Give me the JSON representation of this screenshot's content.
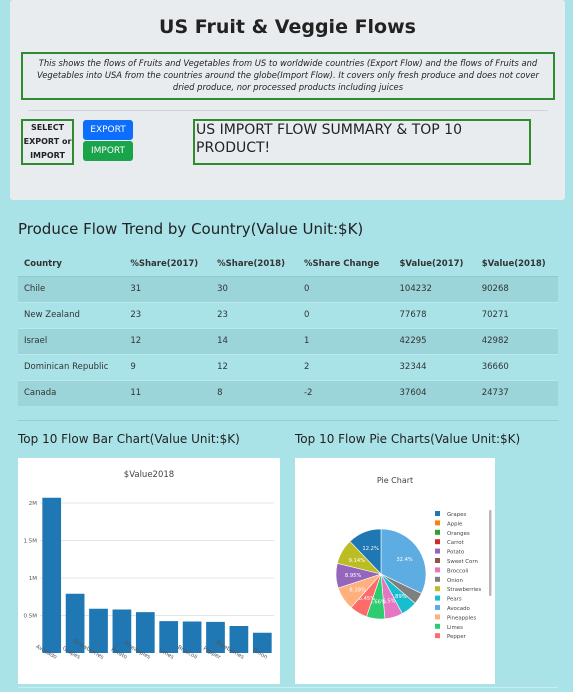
{
  "header": {
    "title": "US Fruit & Veggie Flows",
    "description": "This shows the flows of Fruits and Vegetables from US to worldwide countries (Export Flow) and the flows of Fruits and Vegetables into USA from the countries around the globe(Import Flow). It covers only fresh produce and does not cover dried produce, nor processed products including juices"
  },
  "controls": {
    "select_label_line1": "SELECT",
    "select_label_line2": "EXPORT or",
    "select_label_line3": "IMPORT",
    "export_label": "EXPORT",
    "import_label": "IMPORT",
    "export_color": "#0d6efd",
    "import_color": "#19a34a",
    "summary_title": "US IMPORT FLOW SUMMARY & TOP 10 PRODUCT!"
  },
  "trend": {
    "title": "Produce Flow Trend by Country(Value Unit:$K)",
    "columns": [
      "Country",
      "%Share(2017)",
      "%Share(2018)",
      "%Share Change",
      "$Value(2017)",
      "$Value(2018)"
    ],
    "rows": [
      [
        "Chile",
        "31",
        "30",
        "0",
        "104232",
        "90268"
      ],
      [
        "New Zealand",
        "23",
        "23",
        "0",
        "77678",
        "70271"
      ],
      [
        "Israel",
        "12",
        "14",
        "1",
        "42295",
        "42982"
      ],
      [
        "Dominican Republic",
        "9",
        "12",
        "2",
        "32344",
        "36660"
      ],
      [
        "Canada",
        "11",
        "8",
        "-2",
        "37604",
        "24737"
      ]
    ]
  },
  "bar_section": {
    "title": "Top 10 Flow Bar Chart(Value Unit:$K)"
  },
  "pie_section": {
    "title": "Top 10 Flow Pie Charts(Value Unit:$K)"
  },
  "chart_data": [
    {
      "type": "bar",
      "title": "$Value2018",
      "categories": [
        "Avocado",
        "Grapes",
        "Strawberries",
        "Potato",
        "Pineapples",
        "Limes",
        "Broccoli",
        "Pepper",
        "Blueberries",
        "Onion"
      ],
      "values": [
        2070000,
        790000,
        590000,
        580000,
        545000,
        425000,
        420000,
        415000,
        360000,
        270000
      ],
      "ylim": [
        0,
        2200000
      ],
      "yticks": [
        "2M",
        "1.5M",
        "1M",
        "0.5M"
      ],
      "ytick_values": [
        2000000,
        1500000,
        1000000,
        500000
      ],
      "bar_color": "#1f77b4",
      "grid": true
    },
    {
      "type": "pie",
      "title": "Pie Chart",
      "labels": [
        "Grapes",
        "Apple",
        "Oranges",
        "Carrot",
        "Potato",
        "Sweet Corn",
        "Broccoli",
        "Onion",
        "Strawberries",
        "Pears",
        "Avocado",
        "Pineapples",
        "Limes",
        "Pepper"
      ],
      "colors": [
        "#1f77b4",
        "#ff7f0e",
        "#2ca02c",
        "#d62728",
        "#9467bd",
        "#8c564b",
        "#e377c2",
        "#7f7f7f",
        "#bcbd22",
        "#17becf",
        "#5dade2",
        "#ffb07c",
        "#2ecc71",
        "#ff6b6b"
      ],
      "slices": [
        {
          "label": "Avocado",
          "value": 32.4,
          "color": "#5dade2",
          "text": "32.4%"
        },
        {
          "label": "Onion",
          "value": 4.2,
          "color": "#7f7f7f",
          "text": ""
        },
        {
          "label": "Pears",
          "value": 5.89,
          "color": "#17becf",
          "text": "5.89%"
        },
        {
          "label": "Broccoli",
          "value": 6.5,
          "color": "#e377c2",
          "text": "6.5%"
        },
        {
          "label": "Limes",
          "value": 6.66,
          "color": "#2ecc71",
          "text": "6.66%"
        },
        {
          "label": "Pepper",
          "value": 6.45,
          "color": "#ff6b6b",
          "text": "6.45%"
        },
        {
          "label": "Pineapples",
          "value": 8.39,
          "color": "#ffb07c",
          "text": "8.39%"
        },
        {
          "label": "Potato",
          "value": 8.95,
          "color": "#9467bd",
          "text": "8.95%"
        },
        {
          "label": "Strawberries",
          "value": 9.14,
          "color": "#bcbd22",
          "text": "9.14%"
        },
        {
          "label": "Grapes",
          "value": 12.2,
          "color": "#1f77b4",
          "text": "12.2%"
        }
      ]
    }
  ]
}
